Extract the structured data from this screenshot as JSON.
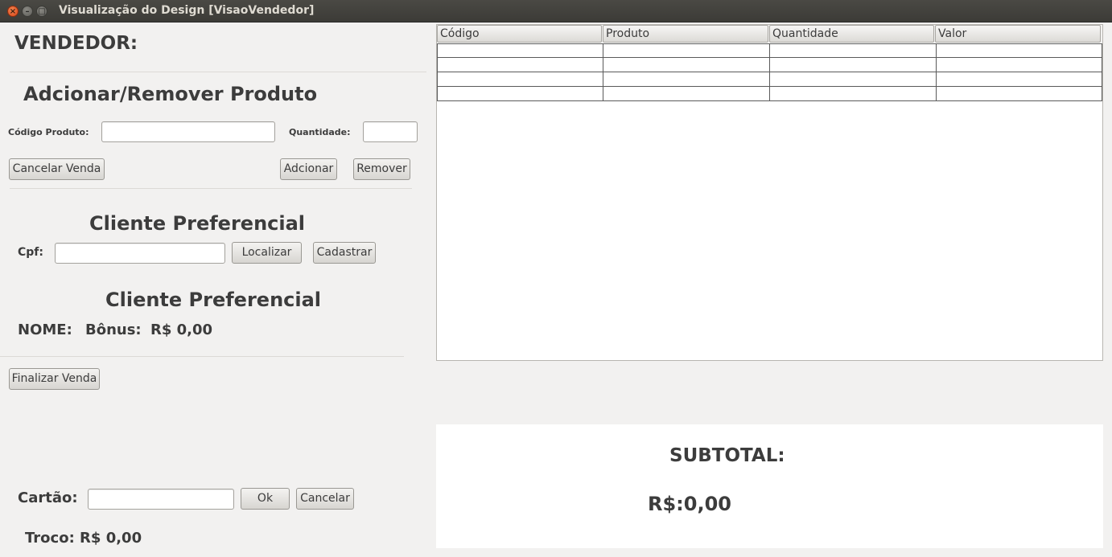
{
  "window": {
    "title": "Visualização do Design [VisaoVendedor]"
  },
  "left": {
    "vendedor_label": "VENDEDOR:",
    "produto_section_title": "Adcionar/Remover Produto",
    "codigo_label": "Código Produto:",
    "codigo_value": "",
    "quantidade_label": "Quantidade:",
    "quantidade_value": "",
    "cancelar_venda": "Cancelar Venda",
    "adicionar": "Adcionar",
    "remover": "Remover",
    "cliente_title": "Cliente Preferencial",
    "cpf_label": "Cpf:",
    "cpf_value": "",
    "localizar": "Localizar",
    "cadastrar": "Cadastrar",
    "cliente_info_title": "Cliente Preferencial",
    "nome_label": "NOME:",
    "bonus_label": "Bônus:",
    "bonus_value": "R$ 0,00",
    "finalizar_venda": "Finalizar Venda",
    "cartao_label": "Cartão:",
    "cartao_value": "",
    "ok": "Ok",
    "cancelar": "Cancelar",
    "troco": "Troco: R$ 0,00"
  },
  "table": {
    "columns": [
      "Código",
      "Produto",
      "Quantidade",
      "Valor"
    ],
    "rows": [
      [
        "",
        "",
        "",
        ""
      ],
      [
        "",
        "",
        "",
        ""
      ],
      [
        "",
        "",
        "",
        ""
      ],
      [
        "",
        "",
        "",
        ""
      ]
    ]
  },
  "subtotal": {
    "label": "SUBTOTAL:",
    "value": "R$:0,00"
  }
}
